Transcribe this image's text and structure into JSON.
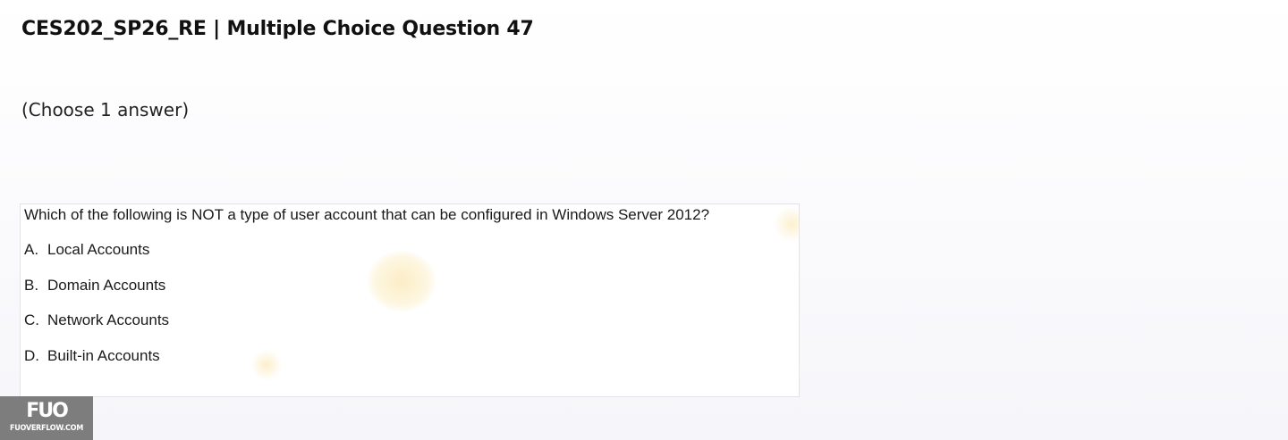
{
  "header": {
    "title": "CES202_SP26_RE | Multiple Choice Question 47"
  },
  "instruction": "(Choose 1 answer)",
  "question": {
    "text": "Which of the following is NOT a type of user account that can be configured in Windows Server 2012?",
    "options": [
      {
        "letter": "A.",
        "text": "Local Accounts"
      },
      {
        "letter": "B.",
        "text": "Domain Accounts"
      },
      {
        "letter": "C.",
        "text": "Network Accounts"
      },
      {
        "letter": "D.",
        "text": "Built-in Accounts"
      }
    ]
  },
  "watermark": {
    "mark": "FUO",
    "site": "FUOVERFLOW.COM"
  }
}
